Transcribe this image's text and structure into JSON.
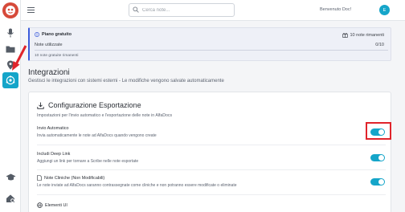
{
  "topbar": {
    "search_placeholder": "Cerca note...",
    "welcome": "Benvenuto Doc!",
    "avatar_initial": "E"
  },
  "plan": {
    "title": "Piano gratuito",
    "remaining_label": "10 note rimanenti",
    "used_label": "Note utilizzate",
    "used_count": "0/10",
    "used_fraction": 0,
    "free_remaining": "10 note gratuite rimanenti"
  },
  "page": {
    "title": "Integrazioni",
    "subtitle": "Gestisci le integrazioni con sistemi esterni - Le modifiche vengono salvate automaticamente"
  },
  "config": {
    "title": "Configurazione Esportazione",
    "subtitle": "Impostazioni per l'invio automatico e l'esportazione delle note in AlfaDocs",
    "rows": [
      {
        "label": "Invio Automatico",
        "desc": "Invia automaticamente le note ad AlfaDocs quando vengono create",
        "enabled": true
      },
      {
        "label": "Includi Deep Link",
        "desc": "Aggiungi un link per tornare a Scribe nelle note esportate",
        "enabled": true
      },
      {
        "label": "Note Cliniche (Non Modificabili)",
        "desc": "Le note inviate ad AlfaDocs saranno contrassegnate come cliniche e non potranno essere modificate o eliminate",
        "enabled": true
      },
      {
        "label": "Elementi UI",
        "desc": "",
        "enabled": null
      }
    ]
  },
  "colors": {
    "accent": "#15a5c9",
    "plan_border": "#3b5bdb",
    "highlight": "#e0242b",
    "logo": "#d64a3a"
  }
}
